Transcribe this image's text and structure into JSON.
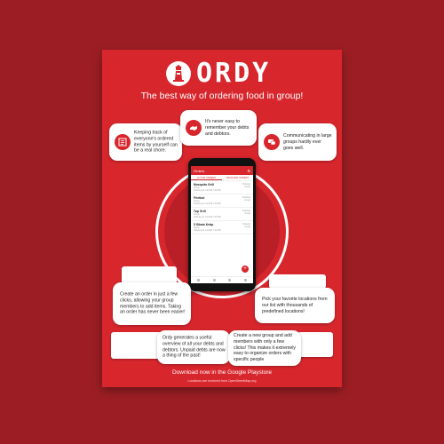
{
  "brand": {
    "name": "ORDY",
    "tagline": "The best way of ordering food in group!"
  },
  "bubbles": {
    "top_left": "Keeping track of everyone's ordered items by yourself can be a real chore.",
    "top_center": "It's never easy to remember your debts and debtors.",
    "top_right": "Communicating in large groups hardly ever goes well.",
    "mid_left": "Create an order in just a few clicks, allowing your group members to add items. Taking an order has never been easier!",
    "mid_right": "Pick your favorite locations from our list with thousands of predefined locations!",
    "bottom_left": "Ordy generates a useful overview of all your debts and debtors. Unpaid debts are now a thing of the past!",
    "bottom_right": "Create a new group and add members with only a few clicks! This makes it extremely easy to organize orders with specific people"
  },
  "phone": {
    "title": "Orders",
    "tabs": [
      "ACTIVE ORDERS",
      "ARCHIVED ORDERS"
    ],
    "orders": [
      {
        "name": "Mosquito Grill",
        "group": "Group",
        "time": "Ordering at: 11/1/18 7:30 PM",
        "rt1": "Ordering",
        "rt2": "Group"
      },
      {
        "name": "Frietkot",
        "group": "Group",
        "time": "Ordering at: 11/1/18 7:30 PM",
        "rt1": "Ordering",
        "rt2": "Group"
      },
      {
        "name": "Top Grill",
        "group": "Group",
        "time": "Ordering at: 11/1/18 7:30 PM",
        "rt1": "Ordering",
        "rt2": "Group"
      },
      {
        "name": "5 Sikaio Kebp",
        "group": "Group",
        "time": "Ordering at: 11/1/18 7:30 PM",
        "rt1": "Ordering",
        "rt2": "Group"
      }
    ],
    "fab": "+"
  },
  "footer": {
    "download": "Download now in the Google Playstore",
    "credits": "Locations are received from OpenStreetMap.org"
  },
  "colors": {
    "background": "#9c1e24",
    "poster": "#d8262d",
    "accent": "#d8262d"
  },
  "icons": {
    "logo": "lighthouse-icon",
    "top_left": "checklist-icon",
    "top_center": "handshake-icon",
    "top_right": "chat-icon"
  }
}
